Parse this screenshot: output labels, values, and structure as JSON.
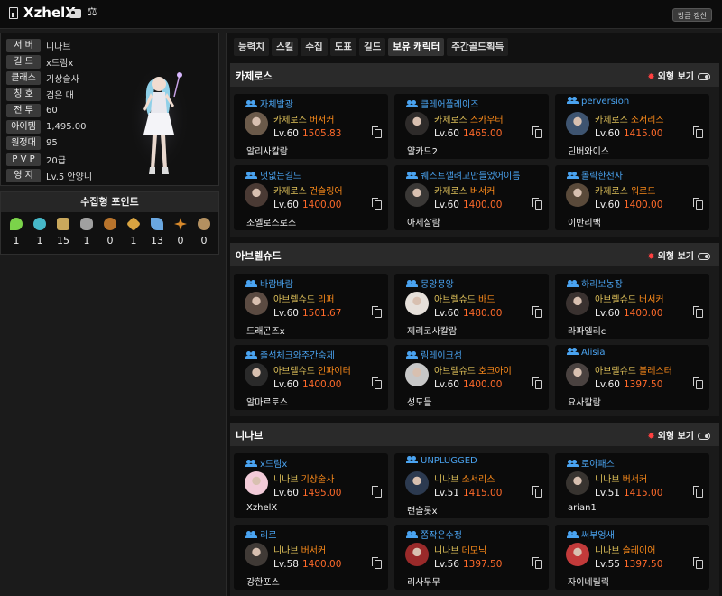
{
  "header": {
    "title": "XzhelX",
    "refresh_label": "방금 갱신"
  },
  "profile": {
    "rows": [
      {
        "label": "서 버",
        "value": "니나브"
      },
      {
        "label": "길 드",
        "value": "x드림x"
      },
      {
        "label": "클래스",
        "value": "기상술사"
      },
      {
        "label": "칭 호",
        "value": "검은 매"
      },
      {
        "label": "전 투",
        "value": "60"
      },
      {
        "label": "아이템",
        "value": "1,495.00"
      },
      {
        "label": "원정대",
        "value": "95"
      },
      {
        "label": "P V P",
        "value": "20급"
      },
      {
        "label": "영 지",
        "value": "Lv.5 안양니"
      }
    ]
  },
  "collect": {
    "title": "수집형 포인트",
    "items": [
      {
        "icon": "mokoko-seed-icon",
        "count": "1",
        "color": "#7bd34a"
      },
      {
        "icon": "island-heart-icon",
        "count": "1",
        "color": "#46b8c8"
      },
      {
        "icon": "great-art-icon",
        "count": "15",
        "color": "#c9a85c"
      },
      {
        "icon": "giant-heart-icon",
        "count": "1",
        "color": "#a0a0a0"
      },
      {
        "icon": "ignea-token-icon",
        "count": "0",
        "color": "#b8742c"
      },
      {
        "icon": "sea-bounty-icon",
        "count": "1",
        "color": "#d9a441"
      },
      {
        "icon": "world-tree-leaf-icon",
        "count": "13",
        "color": "#6aa7e0"
      },
      {
        "icon": "orpheus-star-icon",
        "count": "0",
        "color": "#d98a2b"
      },
      {
        "icon": "mokoko-medal-icon",
        "count": "0",
        "color": "#b39060"
      }
    ]
  },
  "tabs": [
    "능력치",
    "스킬",
    "수집",
    "도표",
    "길드",
    "보유 캐릭터",
    "주간골드획득"
  ],
  "view_label": "외형 보기",
  "sections": [
    {
      "title": "카제로스",
      "cards": [
        {
          "guild": "자체발광",
          "server": "카제로스",
          "cls": "버서커",
          "lv": "Lv.60",
          "il": "1505.83",
          "name": "알리사칼람"
        },
        {
          "guild": "클레어플레이즈",
          "server": "카제로스",
          "cls": "스카우터",
          "lv": "Lv.60",
          "il": "1465.00",
          "name": "얄카드2"
        },
        {
          "guild": "perversion",
          "server": "카제로스",
          "cls": "소서리스",
          "lv": "Lv.60",
          "il": "1415.00",
          "name": "딘버와이스"
        },
        {
          "guild": "덧없는길드",
          "server": "카제로스",
          "cls": "건슬링어",
          "lv": "Lv.60",
          "il": "1400.00",
          "name": "조엘로스로스"
        },
        {
          "guild": "퀘스트깰려고만들었어이름",
          "server": "카제로스",
          "cls": "버서커",
          "lv": "Lv.60",
          "il": "1400.00",
          "name": "아세살람"
        },
        {
          "guild": "몰락한천사",
          "server": "카제로스",
          "cls": "워로드",
          "lv": "Lv.60",
          "il": "1400.00",
          "name": "이반리백"
        }
      ]
    },
    {
      "title": "아브렐슈드",
      "cards": [
        {
          "guild": "바람바람",
          "server": "아브렐슈드",
          "cls": "리퍼",
          "lv": "Lv.60",
          "il": "1501.67",
          "name": "드래곤즈x"
        },
        {
          "guild": "뭉앙뭉앙",
          "server": "아브렐슈드",
          "cls": "바드",
          "lv": "Lv.60",
          "il": "1480.00",
          "name": "제리코사칼람"
        },
        {
          "guild": "하리보농장",
          "server": "아브렐슈드",
          "cls": "버서커",
          "lv": "Lv.60",
          "il": "1400.00",
          "name": "라파엘리c"
        },
        {
          "guild": "출석체크와주간숙제",
          "server": "아브렐슈드",
          "cls": "인파이터",
          "lv": "Lv.60",
          "il": "1400.00",
          "name": "알마르토스"
        },
        {
          "guild": "림레이크섬",
          "server": "아브렐슈드",
          "cls": "호크아이",
          "lv": "Lv.60",
          "il": "1400.00",
          "name": "성도들"
        },
        {
          "guild": "Alisia",
          "server": "아브렐슈드",
          "cls": "블레스터",
          "lv": "Lv.60",
          "il": "1397.50",
          "name": "요사칼람"
        }
      ]
    },
    {
      "title": "니나브",
      "cards": [
        {
          "guild": "x드림x",
          "server": "니나브",
          "cls": "기상술사",
          "lv": "Lv.60",
          "il": "1495.00",
          "name": "XzhelX"
        },
        {
          "guild": "UNPLUGGED",
          "server": "니나브",
          "cls": "소서리스",
          "lv": "Lv.51",
          "il": "1415.00",
          "name": "랜슬롯x"
        },
        {
          "guild": "로아패스",
          "server": "니나브",
          "cls": "버서커",
          "lv": "Lv.51",
          "il": "1415.00",
          "name": "arian1"
        },
        {
          "guild": "리르",
          "server": "니나브",
          "cls": "버서커",
          "lv": "Lv.58",
          "il": "1400.00",
          "name": "강한포스"
        },
        {
          "guild": "쫌작은수정",
          "server": "니나브",
          "cls": "데모닉",
          "lv": "Lv.56",
          "il": "1397.50",
          "name": "리사무무"
        },
        {
          "guild": "써부엉새",
          "server": "니나브",
          "cls": "슬레이어",
          "lv": "Lv.55",
          "il": "1397.50",
          "name": "자이네릴릭"
        }
      ]
    }
  ]
}
